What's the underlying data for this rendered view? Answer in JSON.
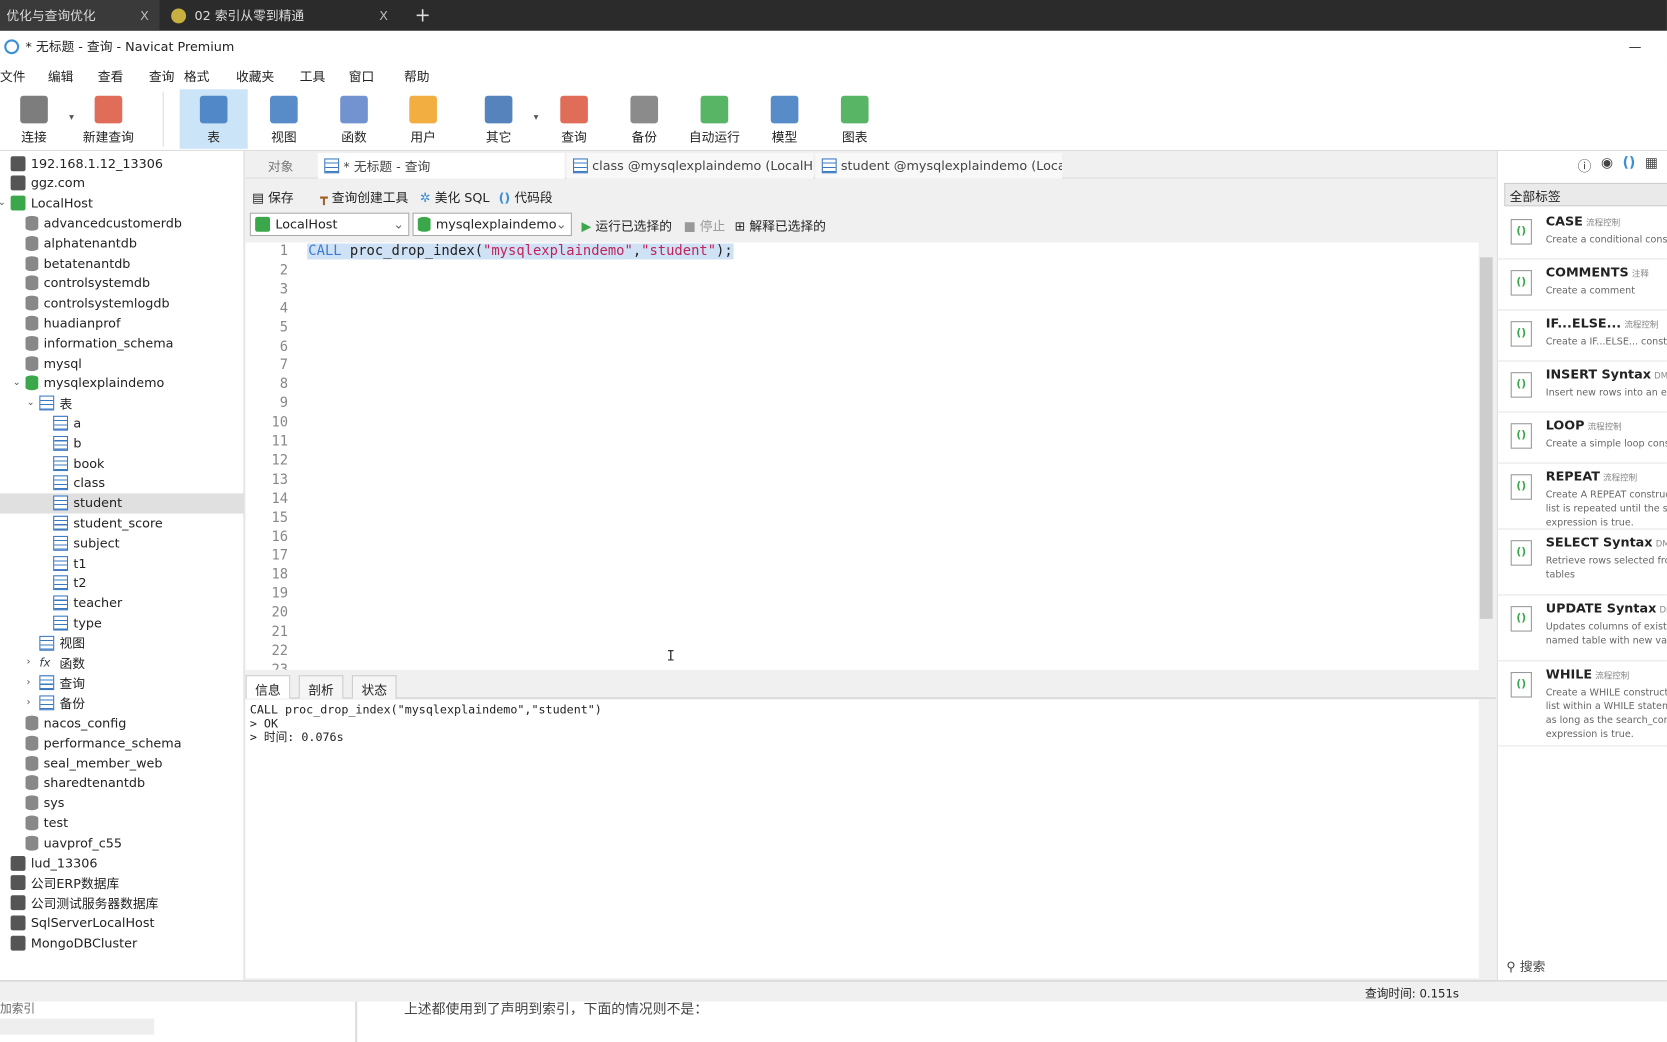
{
  "browser": {
    "tabs": [
      {
        "label": "优化与查询优化"
      },
      {
        "label": "02 索引从零到精通"
      }
    ],
    "close": "X",
    "new_tab": "+"
  },
  "window": {
    "title": "* 无标题 - 查询 - Navicat Premium",
    "minimize": "—"
  },
  "menu": [
    "文件",
    "编辑",
    "查看",
    "查询",
    "格式",
    "收藏夹",
    "工具",
    "窗口",
    "帮助"
  ],
  "toolbar": [
    {
      "label": "连接",
      "color": "#666"
    },
    {
      "label": "新建查询",
      "color": "#d9533b"
    },
    {
      "label": "表",
      "color": "#3a78c0",
      "active": true
    },
    {
      "label": "视图",
      "color": "#3a78c0"
    },
    {
      "label": "函数",
      "color": "#5a7fc8"
    },
    {
      "label": "用户",
      "color": "#f0a020"
    },
    {
      "label": "其它",
      "color": "#3a6db0"
    },
    {
      "label": "查询",
      "color": "#d9533b"
    },
    {
      "label": "备份",
      "color": "#777"
    },
    {
      "label": "自动运行",
      "color": "#3aa84a"
    },
    {
      "label": "模型",
      "color": "#3a78c0"
    },
    {
      "label": "图表",
      "color": "#3aa84a"
    }
  ],
  "tree": [
    {
      "label": "192.168.1.12_13306",
      "type": "conn",
      "level": 0
    },
    {
      "label": "ggz.com",
      "type": "conn",
      "level": 0
    },
    {
      "label": "LocalHost",
      "type": "conng",
      "level": 0,
      "open": true
    },
    {
      "label": "advancedcustomerdb",
      "type": "db",
      "level": 1
    },
    {
      "label": "alphatenantdb",
      "type": "db",
      "level": 1
    },
    {
      "label": "betatenantdb",
      "type": "db",
      "level": 1
    },
    {
      "label": "controlsystemdb",
      "type": "db",
      "level": 1
    },
    {
      "label": "controlsystemlogdb",
      "type": "db",
      "level": 1
    },
    {
      "label": "huadianprof",
      "type": "db",
      "level": 1
    },
    {
      "label": "information_schema",
      "type": "db",
      "level": 1
    },
    {
      "label": "mysql",
      "type": "db",
      "level": 1
    },
    {
      "label": "mysqlexplaindemo",
      "type": "dbg",
      "level": 1,
      "open": true
    },
    {
      "label": "表",
      "type": "tbl",
      "level": 2,
      "open": true
    },
    {
      "label": "a",
      "type": "tbl",
      "level": 3
    },
    {
      "label": "b",
      "type": "tbl",
      "level": 3
    },
    {
      "label": "book",
      "type": "tbl",
      "level": 3
    },
    {
      "label": "class",
      "type": "tbl",
      "level": 3
    },
    {
      "label": "student",
      "type": "tbl",
      "level": 3,
      "selected": true
    },
    {
      "label": "student_score",
      "type": "tbl",
      "level": 3
    },
    {
      "label": "subject",
      "type": "tbl",
      "level": 3
    },
    {
      "label": "t1",
      "type": "tbl",
      "level": 3
    },
    {
      "label": "t2",
      "type": "tbl",
      "level": 3
    },
    {
      "label": "teacher",
      "type": "tbl",
      "level": 3
    },
    {
      "label": "type",
      "type": "tbl",
      "level": 3
    },
    {
      "label": "视图",
      "type": "view",
      "level": 2
    },
    {
      "label": "函数",
      "type": "fx",
      "level": 2,
      "closed": true
    },
    {
      "label": "查询",
      "type": "query",
      "level": 2,
      "closed": true
    },
    {
      "label": "备份",
      "type": "backup",
      "level": 2,
      "closed": true
    },
    {
      "label": "nacos_config",
      "type": "db",
      "level": 1
    },
    {
      "label": "performance_schema",
      "type": "db",
      "level": 1
    },
    {
      "label": "seal_member_web",
      "type": "db",
      "level": 1
    },
    {
      "label": "sharedtenantdb",
      "type": "db",
      "level": 1
    },
    {
      "label": "sys",
      "type": "db",
      "level": 1
    },
    {
      "label": "test",
      "type": "db",
      "level": 1
    },
    {
      "label": "uavprof_c55",
      "type": "db",
      "level": 1
    },
    {
      "label": "lud_13306",
      "type": "conn",
      "level": 0
    },
    {
      "label": "公司ERP数据库",
      "type": "conn",
      "level": 0
    },
    {
      "label": "公司测试服务器数据库",
      "type": "conn",
      "level": 0
    },
    {
      "label": "SqlServerLocalHost",
      "type": "conn",
      "level": 0
    },
    {
      "label": "MongoDBCluster",
      "type": "conn",
      "level": 0
    }
  ],
  "doc_tabs": {
    "objects": "对象",
    "active": "* 无标题 - 查询",
    "others": [
      "class @mysqlexplaindemo (LocalHo...",
      "student @mysqlexplaindemo (Local..."
    ]
  },
  "query_toolbar": {
    "save": "保存",
    "builder": "查询创建工具",
    "beautify": "美化 SQL",
    "snippet": "代码段",
    "run": "运行已选择的",
    "stop": "停止",
    "explain": "解释已选择的"
  },
  "connection_select": "LocalHost",
  "database_select": "mysqlexplaindemo",
  "editor": {
    "code_kw": "CALL",
    "code_fn": " proc_drop_index(",
    "code_s1": "\"mysqlexplaindemo\"",
    "code_comma": ",",
    "code_s2": "\"student\"",
    "code_end": ");",
    "line_count": 23
  },
  "result_tabs": [
    "信息",
    "剖析",
    "状态"
  ],
  "result_lines": [
    "CALL proc_drop_index(\"mysqlexplaindemo\",\"student\")",
    "> OK",
    "> 时间: 0.076s"
  ],
  "right_panel": {
    "filter": "全部标签",
    "search": "搜索",
    "snippets": [
      {
        "title": "CASE",
        "tag": "流程控制",
        "desc": "Create a conditional construct"
      },
      {
        "title": "COMMENTS",
        "tag": "注释",
        "desc": "Create a comment"
      },
      {
        "title": "IF...ELSE...",
        "tag": "流程控制",
        "desc": "Create a IF...ELSE... construct"
      },
      {
        "title": "INSERT Syntax",
        "tag": "DML",
        "desc": "Insert new rows into an existing"
      },
      {
        "title": "LOOP",
        "tag": "流程控制",
        "desc": "Create a simple loop construct"
      },
      {
        "title": "REPEAT",
        "tag": "流程控制",
        "desc": "Create A REPEAT construct. T\nlist is repeated until the search\nexpression is true."
      },
      {
        "title": "SELECT Syntax",
        "tag": "DML",
        "desc": "Retrieve rows selected from o\ntables"
      },
      {
        "title": "UPDATE Syntax",
        "tag": "DML",
        "desc": "Updates columns of existing\nnamed table with new values"
      },
      {
        "title": "WHILE",
        "tag": "流程控制",
        "desc": "Create a WHILE construct. T\nlist within a WHILE statement\nas long as the search_conditi\nexpression is true."
      }
    ]
  },
  "status": {
    "query_time": "查询时间: 0.151s"
  },
  "background_page": {
    "left_text": "加索引",
    "text": "上述都使用到了声明到索引，下面的情况则不是："
  }
}
